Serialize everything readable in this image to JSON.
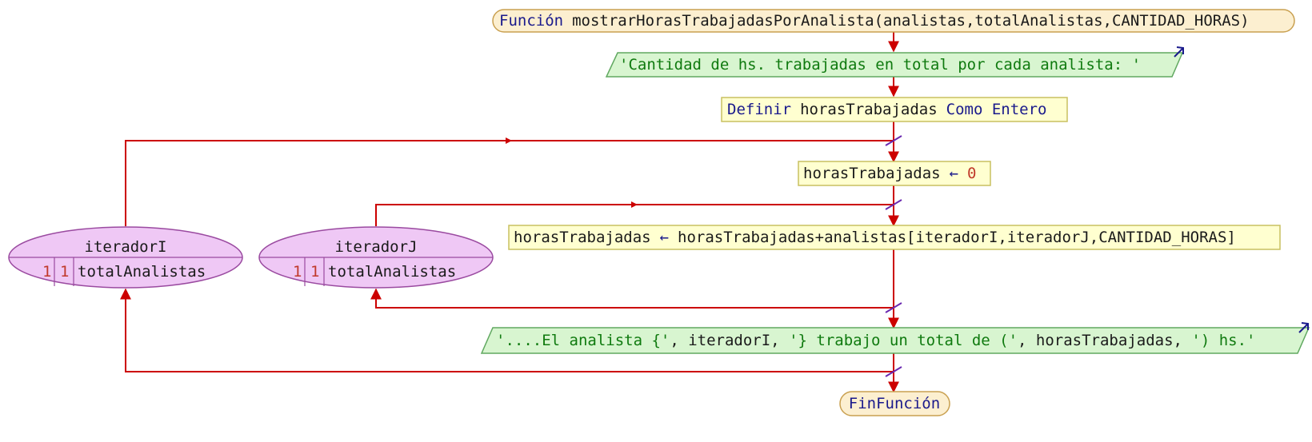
{
  "function_header": {
    "keyword": "Función",
    "signature": "mostrarHorasTrabajadasPorAnalista(analistas,totalAnalistas,CANTIDAD_HORAS)"
  },
  "output_1": {
    "text": "'Cantidad de hs. trabajadas en total por cada analista: '"
  },
  "define_stmt": {
    "kw_define": "Definir",
    "var": "horasTrabajadas",
    "kw_type": "Como Entero"
  },
  "assign_init": {
    "var": "horasTrabajadas",
    "arrow": "←",
    "value": "0"
  },
  "assign_sum": {
    "var": "horasTrabajadas",
    "arrow": "←",
    "expr": "horasTrabajadas+analistas[iteradorI,iteradorJ,CANTIDAD_HORAS]"
  },
  "output_2": {
    "s1": "'....El analista {'",
    "sep1": ", iteradorI, ",
    "s2": "'} trabajo un total de ('",
    "sep2": ", horasTrabajadas, ",
    "s3": "') hs.'"
  },
  "loop_outer": {
    "var": "iteradorI",
    "start": "1",
    "step": "1",
    "end": "totalAnalistas"
  },
  "loop_inner": {
    "var": "iteradorJ",
    "start": "1",
    "step": "1",
    "end": "totalAnalistas"
  },
  "function_end": {
    "label": "FinFunción"
  },
  "colors": {
    "flow_line": "#cc0000",
    "terminal_fill": "#fcefd0",
    "terminal_stroke": "#c9a050",
    "process_fill": "#ffffd0",
    "process_stroke": "#c8c060",
    "io_fill": "#d8f5d0",
    "io_stroke": "#60a860",
    "loop_fill": "#efc8f5",
    "loop_stroke": "#9a4aa0",
    "loop_marker": "#6a2ab0",
    "output_arrow": "#1a1a8c"
  }
}
